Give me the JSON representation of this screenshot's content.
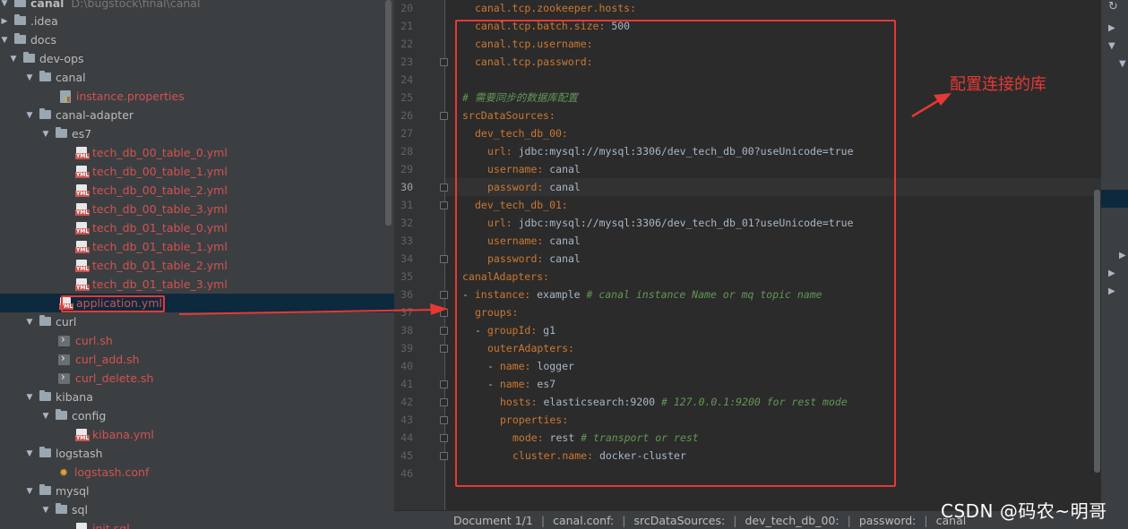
{
  "project": {
    "name": "canal",
    "path": "D:\\bugstock\\final\\canal"
  },
  "tree": [
    {
      "label": "canal",
      "kind": "root"
    },
    {
      "label": ".idea",
      "kind": "folder"
    },
    {
      "label": "docs",
      "kind": "folder"
    },
    {
      "label": "dev-ops",
      "kind": "folder"
    },
    {
      "label": "canal",
      "kind": "folder"
    },
    {
      "label": "instance.properties",
      "kind": "props"
    },
    {
      "label": "canal-adapter",
      "kind": "folder"
    },
    {
      "label": "es7",
      "kind": "folder"
    },
    {
      "label": "tech_db_00_table_0.yml",
      "kind": "yml"
    },
    {
      "label": "tech_db_00_table_1.yml",
      "kind": "yml"
    },
    {
      "label": "tech_db_00_table_2.yml",
      "kind": "yml"
    },
    {
      "label": "tech_db_00_table_3.yml",
      "kind": "yml"
    },
    {
      "label": "tech_db_01_table_0.yml",
      "kind": "yml"
    },
    {
      "label": "tech_db_01_table_1.yml",
      "kind": "yml"
    },
    {
      "label": "tech_db_01_table_2.yml",
      "kind": "yml"
    },
    {
      "label": "tech_db_01_table_3.yml",
      "kind": "yml"
    },
    {
      "label": "application.yml",
      "kind": "yml"
    },
    {
      "label": "curl",
      "kind": "folder"
    },
    {
      "label": "curl.sh",
      "kind": "sh"
    },
    {
      "label": "curl_add.sh",
      "kind": "sh"
    },
    {
      "label": "curl_delete.sh",
      "kind": "sh"
    },
    {
      "label": "kibana",
      "kind": "folder"
    },
    {
      "label": "config",
      "kind": "folder"
    },
    {
      "label": "kibana.yml",
      "kind": "yml"
    },
    {
      "label": "logstash",
      "kind": "folder"
    },
    {
      "label": "logstash.conf",
      "kind": "conf"
    },
    {
      "label": "mysql",
      "kind": "folder"
    },
    {
      "label": "sql",
      "kind": "folder"
    },
    {
      "label": "init.sql",
      "kind": "sql"
    }
  ],
  "editor": {
    "line_numbers": [
      "20",
      "21",
      "22",
      "23",
      "24",
      "25",
      "26",
      "27",
      "28",
      "29",
      "30",
      "31",
      "32",
      "33",
      "34",
      "35",
      "36",
      "37",
      "38",
      "39",
      "40",
      "41",
      "42",
      "43",
      "44",
      "45",
      "46"
    ],
    "current_line": "30",
    "lines": [
      {
        "key": "canal.tcp.zookeeper.hosts:",
        "value": ""
      },
      {
        "key": "canal.tcp.batch.size:",
        "value": " 500"
      },
      {
        "key": "canal.tcp.username:",
        "value": ""
      },
      {
        "key": "canal.tcp.password:",
        "value": ""
      },
      {
        "key": "",
        "value": ""
      },
      {
        "comment": "# 需要同步的数据库配置"
      },
      {
        "key": "srcDataSources:",
        "value": ""
      },
      {
        "key": "dev_tech_db_00:",
        "value": ""
      },
      {
        "key": "url:",
        "value": " jdbc:mysql://mysql:3306/dev_tech_db_00?useUnicode=true"
      },
      {
        "key": "username:",
        "value": " canal"
      },
      {
        "key": "password:",
        "value": " canal"
      },
      {
        "key": "dev_tech_db_01:",
        "value": ""
      },
      {
        "key": "url:",
        "value": " jdbc:mysql://mysql:3306/dev_tech_db_01?useUnicode=true"
      },
      {
        "key": "username:",
        "value": " canal"
      },
      {
        "key": "password:",
        "value": " canal"
      },
      {
        "key": "canalAdapters:",
        "value": ""
      },
      {
        "prefix": "- ",
        "key": "instance:",
        "value": " example ",
        "comment": "# canal instance Name or mq topic name"
      },
      {
        "key": "groups:",
        "value": ""
      },
      {
        "prefix": "- ",
        "key": "groupId:",
        "value": " g1"
      },
      {
        "key": "outerAdapters:",
        "value": ""
      },
      {
        "prefix": "- ",
        "key": "name:",
        "value": " logger"
      },
      {
        "prefix": "- ",
        "key": "name:",
        "value": " es7"
      },
      {
        "key": "hosts:",
        "value": " elasticsearch:9200 ",
        "comment": "# 127.0.0.1:9200 for rest mode"
      },
      {
        "key": "properties:",
        "value": ""
      },
      {
        "key": "mode:",
        "value": " rest ",
        "comment": "# transport or rest"
      },
      {
        "key": "cluster.name:",
        "value": " docker-cluster"
      },
      {
        "key": "",
        "value": ""
      }
    ]
  },
  "breadcrumb": [
    "Document 1/1",
    "canal.conf:",
    "srcDataSources:",
    "dev_tech_db_00:",
    "password:",
    "canal"
  ],
  "annotation": {
    "text": "配置连接的库",
    "color": "#e53935"
  },
  "watermark": "CSDN @码农~明哥",
  "colors": {
    "key": "#cc7832",
    "value": "#a9b7c6",
    "comment": "#629755",
    "modified_file": "#d25252",
    "selection": "#0d293e"
  }
}
